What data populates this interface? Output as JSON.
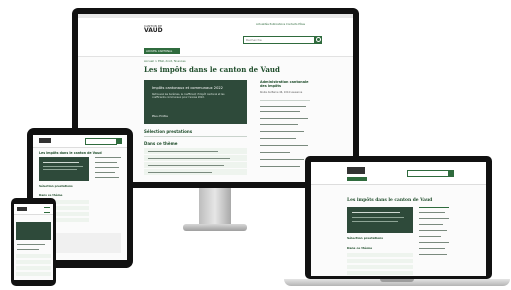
{
  "site": {
    "logo_top": "CANTON DE",
    "logo_main": "VAUD",
    "nav_label": "ACCUEIL CANTONAL",
    "search_placeholder": "Recherche",
    "header_links": "Actualités  Publications  Contacts  Pôles",
    "breadcrumb": "Accueil > Etat, droit, finances",
    "page_title": "Les impôts dans le canton de Vaud",
    "panel_title": "Impôts cantonaux et communaux 2022",
    "panel_text": "Retrouvez les barèmes, le coefficient d'impôt cantonal et les coefficients communaux pour l'année 2022.",
    "panel_link": "Plus d'infos",
    "section1": "Sélection prestations",
    "section2": "Dans ce thème",
    "sidebar_title": "Administration cantonale des impôts",
    "sidebar_sub": "Route de Berne 46, 1014 Lausanne"
  },
  "tablet": {
    "page_title": "Les impôts dans le canton de Vaud",
    "section1": "Sélection prestations",
    "section2": "Dans ce thème"
  },
  "laptop": {
    "page_title": "Les impôts dans le canton de Vaud",
    "section1": "Sélection prestations",
    "section2": "Dans ce thème"
  },
  "colors": {
    "brand_green": "#2f6b3d",
    "panel_dark": "#2e4a3a",
    "light_green": "#eaf3ea"
  }
}
